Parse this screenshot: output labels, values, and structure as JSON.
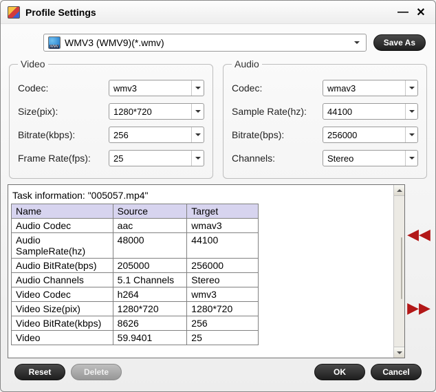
{
  "title": "Profile Settings",
  "profile": {
    "selected": "WMV3 (WMV9)(*.wmv)",
    "save_as_label": "Save As"
  },
  "video": {
    "legend": "Video",
    "codec_label": "Codec:",
    "codec_value": "wmv3",
    "size_label": "Size(pix):",
    "size_value": "1280*720",
    "bitrate_label": "Bitrate(kbps):",
    "bitrate_value": "256",
    "framerate_label": "Frame Rate(fps):",
    "framerate_value": "25"
  },
  "audio": {
    "legend": "Audio",
    "codec_label": "Codec:",
    "codec_value": "wmav3",
    "samplerate_label": "Sample Rate(hz):",
    "samplerate_value": "44100",
    "bitrate_label": "Bitrate(bps):",
    "bitrate_value": "256000",
    "channels_label": "Channels:",
    "channels_value": "Stereo"
  },
  "task": {
    "heading": "Task information: \"005057.mp4\"",
    "cols": {
      "name": "Name",
      "source": "Source",
      "target": "Target"
    },
    "rows": [
      {
        "name": "Audio Codec",
        "source": "aac",
        "target": "wmav3"
      },
      {
        "name": "Audio SampleRate(hz)",
        "source": "48000",
        "target": "44100"
      },
      {
        "name": "Audio BitRate(bps)",
        "source": "205000",
        "target": "256000"
      },
      {
        "name": "Audio Channels",
        "source": "5.1 Channels",
        "target": "Stereo"
      },
      {
        "name": "Video Codec",
        "source": "h264",
        "target": "wmv3"
      },
      {
        "name": "Video Size(pix)",
        "source": "1280*720",
        "target": "1280*720"
      },
      {
        "name": "Video BitRate(kbps)",
        "source": "8626",
        "target": "256"
      },
      {
        "name": "Video",
        "source": "59.9401",
        "target": "25"
      }
    ]
  },
  "footer": {
    "reset_label": "Reset",
    "delete_label": "Delete",
    "ok_label": "OK",
    "cancel_label": "Cancel"
  }
}
